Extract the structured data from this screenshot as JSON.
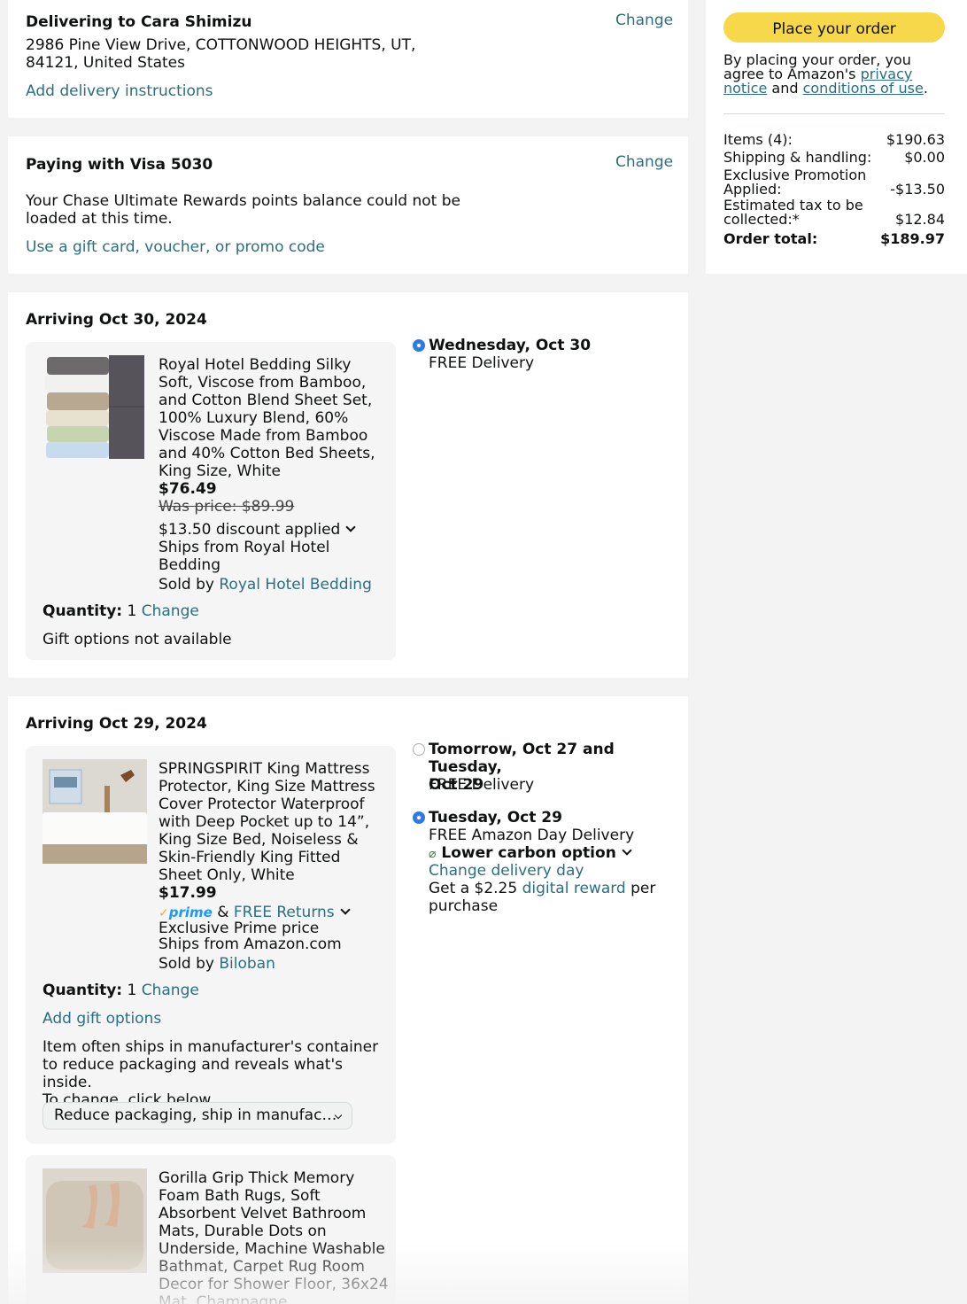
{
  "delivery": {
    "heading": "Delivering to Cara Shimizu",
    "change": "Change",
    "address_line1": "2986 Pine View Drive, COTTONWOOD HEIGHTS, UT,",
    "address_line2": "84121, United States",
    "instructions_link": "Add delivery instructions"
  },
  "payment": {
    "heading": "Paying with Visa 5030",
    "change": "Change",
    "rewards_line1": "Your Chase Ultimate Rewards points balance could not be",
    "rewards_line2": "loaded at this time.",
    "gift_link": "Use a gift card, voucher, or promo code"
  },
  "shipment1": {
    "heading": "Arriving Oct 30, 2024",
    "product_title_lines": [
      "Royal Hotel Bedding Silky",
      "Soft, Viscose from Bamboo,",
      "and Cotton Blend Sheet Set,",
      "100% Luxury Blend, 60%",
      "Viscose Made from Bamboo",
      "and 40% Cotton Bed Sheets,",
      "King Size, White"
    ],
    "price": "$76.49",
    "was_price": "Was price: $89.99",
    "discount": "$13.50 discount applied",
    "ships_from_lines": [
      "Ships from Royal Hotel",
      "Bedding"
    ],
    "sold_by_label": "Sold by",
    "sold_by": "Royal Hotel Bedding",
    "quantity_label": "Quantity:",
    "quantity": "1",
    "quantity_change": "Change",
    "gift": "Gift options not available",
    "option1_title": "Wednesday, Oct 30",
    "option1_sub": "FREE Delivery"
  },
  "shipment2": {
    "heading": "Arriving Oct 29, 2024",
    "product_title_lines": [
      "SPRINGSPIRIT King Mattress",
      "Protector, King Size Mattress",
      "Cover Protector Waterproof",
      "with Deep Pocket up to 14”,",
      "King Size Bed, Noiseless &",
      "Skin-Friendly King Fitted",
      "Sheet Only, White"
    ],
    "price": "$17.99",
    "prime": "prime",
    "prime_amp": "&",
    "free_returns": "FREE Returns",
    "exclusive": "Exclusive Prime price",
    "ships_from": "Ships from Amazon.com",
    "sold_by_label": "Sold by",
    "sold_by": "Biloban",
    "quantity_label": "Quantity:",
    "quantity": "1",
    "quantity_change": "Change",
    "gift_link": "Add gift options",
    "packaging_lines": [
      "Item often ships in manufacturer's container",
      "to reduce packaging and reveals what's inside.",
      "To change, click below."
    ],
    "packaging_select": "Reduce packaging, ship in manufac…",
    "option1_title_line1": "Tomorrow, Oct 27 and Tuesday,",
    "option1_title_line2": "Oct 29",
    "option1_sub": "FREE Delivery",
    "option2_title": "Tuesday, Oct 29",
    "option2_sub": "FREE Amazon Day Delivery",
    "carbon": "Lower carbon option",
    "change_day": "Change delivery day",
    "reward_prefix": "Get a $2.25",
    "reward_link": "digital reward",
    "reward_suffix": "per",
    "reward_line2": "purchase",
    "item2_title_lines": [
      "Gorilla Grip Thick Memory",
      "Foam Bath Rugs, Soft",
      "Absorbent Velvet Bathroom",
      "Mats, Durable Dots on",
      "Underside, Machine Washable",
      "Bathmat, Carpet Rug Room",
      "Decor for Shower Floor, 36x24",
      "Mat, Champagne"
    ]
  },
  "summary": {
    "place_order": "Place your order",
    "legal_1": "By placing your order, you",
    "legal_2": "agree to Amazon's",
    "privacy_1": "privacy",
    "privacy_2": "notice",
    "and": "and",
    "conditions": "conditions of use",
    "period": ".",
    "items_label": "Items (4):",
    "items_value": "$190.63",
    "shipping_label": "Shipping & handling:",
    "shipping_value": "$0.00",
    "promo_label_1": "Exclusive Promotion",
    "promo_label_2": "Applied:",
    "promo_value": "-$13.50",
    "tax_label_1": "Estimated tax to be",
    "tax_label_2": "collected:*",
    "tax_value": "$12.84",
    "total_label": "Order total:",
    "total_value": "$189.97"
  },
  "colors": {
    "link": "#2a6f82",
    "button": "#f7d84a",
    "radio": "#2d7ae5",
    "prime": "#1a98ff"
  }
}
